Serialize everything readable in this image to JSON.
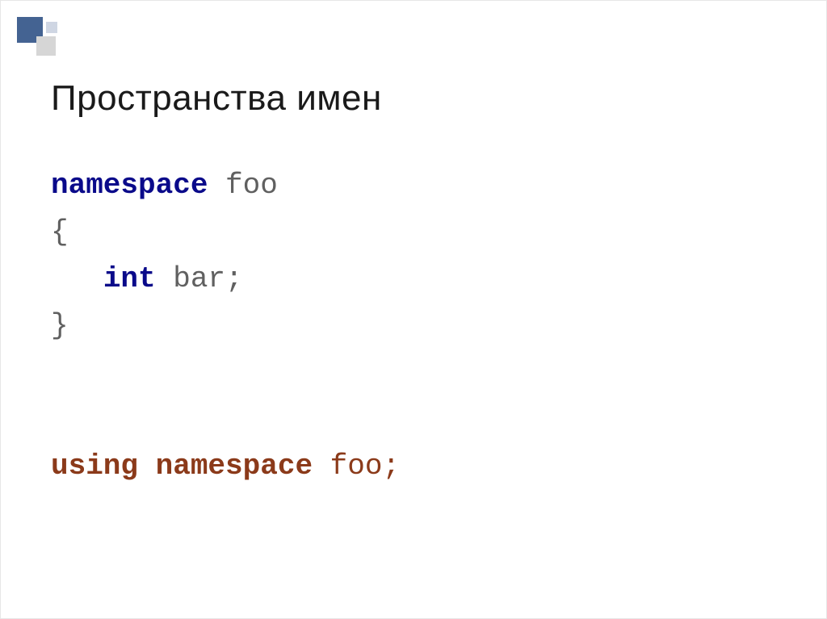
{
  "slide": {
    "title": "Пространства имен",
    "code": {
      "line1_kw": "namespace",
      "line1_name": " foo",
      "line2": "{",
      "line3_indent": "   ",
      "line3_type": "int",
      "line3_rest": " bar;",
      "line4": "}",
      "line7_kw": "using namespace",
      "line7_rest": " foo;"
    }
  }
}
